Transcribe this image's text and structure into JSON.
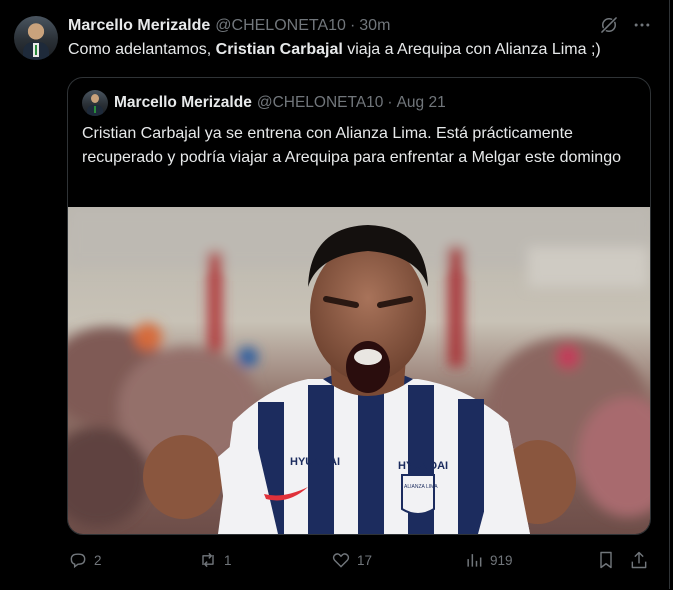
{
  "tweet": {
    "author_name": "Marcello Merizalde",
    "author_handle": "@CHELONETA10",
    "separator": "·",
    "time": "30m",
    "text_before": "Como adelantamos, ",
    "text_bold": "Cristian Carbajal",
    "text_after": " viaja a Arequipa con Alianza Lima ;)"
  },
  "quote": {
    "author_name": "Marcello Merizalde",
    "author_handle": "@CHELONETA10",
    "separator": "·",
    "date": "Aug 21",
    "text": "Cristian Carbajal ya se entrena con Alianza Lima. Está prácticamente recuperado y podría viajar a Arequipa para enfrentar a Melgar este domingo",
    "photo_alt": "Football player in blue and white striped Alianza Lima jersey celebrating with clenched fists",
    "jersey_sponsor": "HYUNDAI",
    "crest_text": "ALIANZA LIMA"
  },
  "actions": {
    "replies": "2",
    "reposts": "1",
    "likes": "17",
    "views": "919"
  },
  "icons": [
    "grok-icon",
    "more-icon",
    "reply-icon",
    "repost-icon",
    "like-icon",
    "views-icon",
    "bookmark-icon",
    "share-icon"
  ],
  "colors": {
    "background": "#000000",
    "text": "#e7e9ea",
    "muted": "#71767b",
    "border": "#2f3336"
  }
}
